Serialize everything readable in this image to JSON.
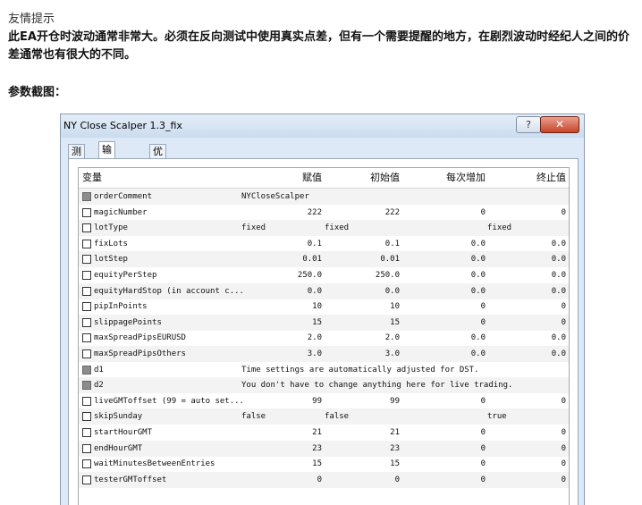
{
  "notice": {
    "title": "友情提示",
    "body": "此EA开仓时波动通常非常大。必须在反向测试中使用真实点差，但有一个需要提醒的地方，在剧烈波动时经纪人之间的价差通常也有很大的不同。"
  },
  "params_label": "参数截图：",
  "dialog": {
    "title": "NY Close Scalper 1.3_fix",
    "help_glyph": "?",
    "close_glyph": "✕",
    "tabs": [
      {
        "label": "测试",
        "active": false
      },
      {
        "label": "输入参数",
        "active": true
      },
      {
        "label": "优化",
        "active": false
      }
    ],
    "columns": {
      "variable": "变量",
      "value": "赋值",
      "initial": "初始值",
      "step": "每次增加",
      "stop": "终止值"
    },
    "rows": [
      {
        "name": "orderComment",
        "value": "NYCloseScalper",
        "initial": "",
        "step": "",
        "stop": "",
        "text_left": true,
        "greyed": true
      },
      {
        "name": "magicNumber",
        "value": "222",
        "initial": "222",
        "step": "0",
        "stop": "0"
      },
      {
        "name": "lotType",
        "value": "fixed",
        "initial": "fixed",
        "step": "",
        "stop": "fixed",
        "text_left": true
      },
      {
        "name": "fixLots",
        "value": "0.1",
        "initial": "0.1",
        "step": "0.0",
        "stop": "0.0"
      },
      {
        "name": "lotStep",
        "value": "0.01",
        "initial": "0.01",
        "step": "0.0",
        "stop": "0.0"
      },
      {
        "name": "equityPerStep",
        "value": "250.0",
        "initial": "250.0",
        "step": "0.0",
        "stop": "0.0"
      },
      {
        "name": "equityHardStop (in account c...",
        "value": "0.0",
        "initial": "0.0",
        "step": "0.0",
        "stop": "0.0"
      },
      {
        "name": "pipInPoints",
        "value": "10",
        "initial": "10",
        "step": "0",
        "stop": "0"
      },
      {
        "name": "slippagePoints",
        "value": "15",
        "initial": "15",
        "step": "0",
        "stop": "0"
      },
      {
        "name": "maxSpreadPipsEURUSD",
        "value": "2.0",
        "initial": "2.0",
        "step": "0.0",
        "stop": "0.0"
      },
      {
        "name": "maxSpreadPipsOthers",
        "value": "3.0",
        "initial": "3.0",
        "step": "0.0",
        "stop": "0.0"
      },
      {
        "name": "d1",
        "note": "Time settings are automatically adjusted for DST.",
        "greyed": true
      },
      {
        "name": "d2",
        "note": "You don't have to change anything here for live trading.",
        "greyed": true
      },
      {
        "name": "liveGMToffset (99 = auto set...",
        "value": "99",
        "initial": "99",
        "step": "0",
        "stop": "0"
      },
      {
        "name": "skipSunday",
        "value": "false",
        "initial": "false",
        "step": "",
        "stop": "true",
        "text_left": true
      },
      {
        "name": "startHourGMT",
        "value": "21",
        "initial": "21",
        "step": "0",
        "stop": "0"
      },
      {
        "name": "endHourGMT",
        "value": "23",
        "initial": "23",
        "step": "0",
        "stop": "0"
      },
      {
        "name": "waitMinutesBetweenEntries",
        "value": "15",
        "initial": "15",
        "step": "0",
        "stop": "0"
      },
      {
        "name": "testerGMToffset",
        "value": "0",
        "initial": "0",
        "step": "0",
        "stop": "0"
      }
    ]
  }
}
